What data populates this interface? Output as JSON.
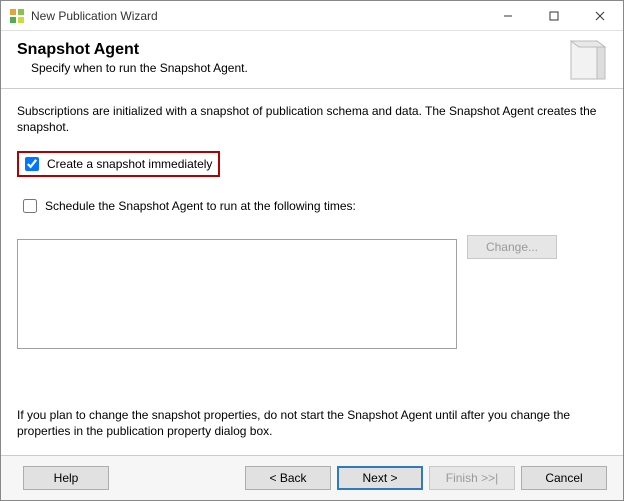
{
  "window": {
    "title": "New Publication Wizard"
  },
  "header": {
    "title": "Snapshot Agent",
    "subtitle": "Specify when to run the Snapshot Agent."
  },
  "body": {
    "description": "Subscriptions are initialized with a snapshot of publication schema and data. The Snapshot Agent creates the snapshot.",
    "check_immediate_label": "Create a snapshot immediately",
    "check_immediate_checked": true,
    "check_schedule_label": "Schedule the Snapshot Agent to run at the following times:",
    "check_schedule_checked": false,
    "change_button": "Change...",
    "note": "If you plan to change the snapshot properties, do not start the Snapshot Agent until after you change the properties in the publication property dialog box."
  },
  "footer": {
    "help": "Help",
    "back": "< Back",
    "next": "Next >",
    "finish": "Finish >>|",
    "cancel": "Cancel"
  }
}
